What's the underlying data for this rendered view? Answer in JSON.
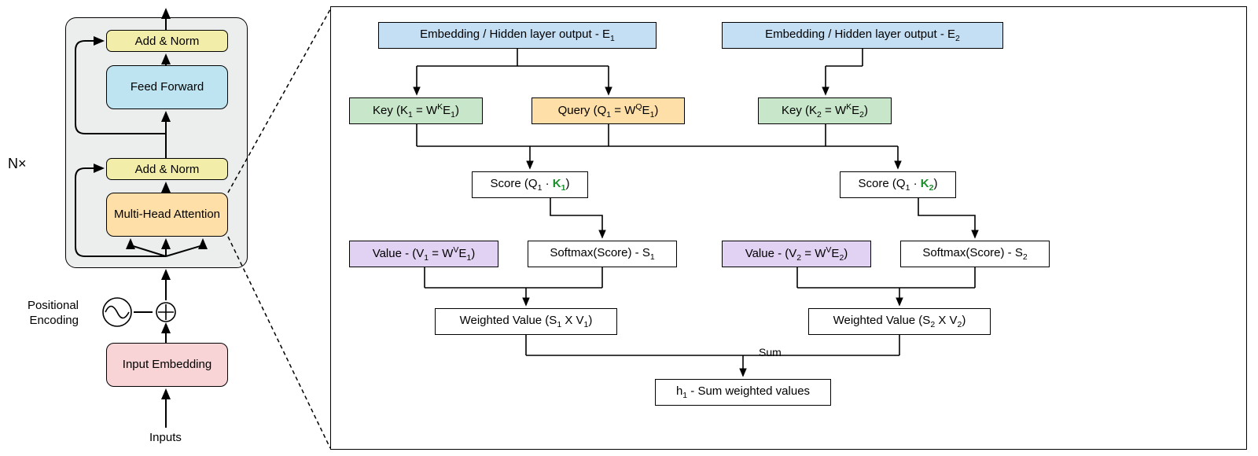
{
  "leftPanel": {
    "nx_label": "N×",
    "addnorm1": "Add & Norm",
    "feedforward": "Feed Forward",
    "addnorm2": "Add & Norm",
    "multihead": "Multi-Head Attention",
    "pos_enc": "Positional Encoding",
    "input_emb": "Input Embedding",
    "inputs": "Inputs"
  },
  "rightPanel": {
    "embE1": "Embedding / Hidden layer output - E",
    "embE1_sub": "1",
    "embE2": "Embedding / Hidden layer output  - E",
    "embE2_sub": "2",
    "key1": "Key (K",
    "key1_sub": "1",
    "key1_eq": " = W",
    "key1_sup": "K",
    "key1_E": "E",
    "key1_Esub": "1",
    "key1_close": ")",
    "query1": "Query (Q",
    "query1_sub": "1",
    "query1_eq": " = W",
    "query1_sup": "Q",
    "query1_E": "E",
    "query1_Esub": "1",
    "query1_close": ")",
    "key2": "Key (K",
    "key2_sub": "2",
    "key2_eq": " = W",
    "key2_sup": "K",
    "key2_E": "E",
    "key2_Esub": "2",
    "key2_close": ")",
    "score1_pre": "Score (Q",
    "score1_sub": "1",
    "score1_dot": " · ",
    "score1_K": "K",
    "score1_Ksub": "1",
    "score1_close": ")",
    "score2_pre": "Score (Q",
    "score2_sub": "1",
    "score2_dot": " · ",
    "score2_K": "K",
    "score2_Ksub": "2",
    "score2_close": ")",
    "value1_pre": "Value - (V",
    "value1_sub": "1",
    "value1_eq": " = W",
    "value1_sup": "V",
    "value1_E": "E",
    "value1_Esub": "1",
    "value1_close": ")",
    "value2_pre": "Value - (V",
    "value2_sub": "2",
    "value2_eq": " = W",
    "value2_sup": "V",
    "value2_E": "E",
    "value2_Esub": "2",
    "value2_close": ")",
    "softmax1": "Softmax(Score) - S",
    "softmax1_sub": "1",
    "softmax2": "Softmax(Score) - S",
    "softmax2_sub": "2",
    "wv1": "Weighted Value (S",
    "wv1_sub": "1",
    "wv1_x": " X V",
    "wv1_vsub": "1",
    "wv1_close": ")",
    "wv2": "Weighted Value (S",
    "wv2_sub": "2",
    "wv2_x": " X V",
    "wv2_vsub": "2",
    "wv2_close": ")",
    "sum_label": "Sum",
    "h1": "h",
    "h1_sub": "1",
    "h1_after": " - Sum weighted values"
  },
  "colors": {
    "blue": "#c4dff4",
    "green_fill": "#c8e6c9",
    "orange": "#ffdfa8",
    "purple": "#e1d1f3",
    "yellow": "#f3edaa",
    "cyan": "#bde4f0",
    "pink": "#f8d4d6",
    "grey": "#eceded"
  }
}
